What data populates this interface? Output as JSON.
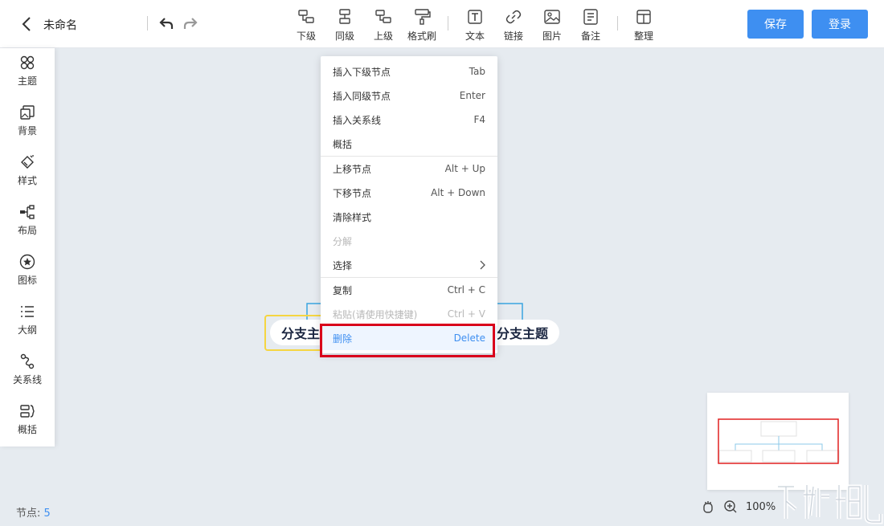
{
  "header": {
    "title": "未命名",
    "toolbar": [
      {
        "label": "下级",
        "icon": "insert-child-icon"
      },
      {
        "label": "同级",
        "icon": "insert-sibling-icon"
      },
      {
        "label": "上级",
        "icon": "insert-parent-icon"
      },
      {
        "label": "格式刷",
        "icon": "format-brush-icon"
      },
      {
        "label": "文本",
        "icon": "text-icon"
      },
      {
        "label": "链接",
        "icon": "link-icon"
      },
      {
        "label": "图片",
        "icon": "image-icon"
      },
      {
        "label": "备注",
        "icon": "note-icon"
      },
      {
        "label": "整理",
        "icon": "arrange-icon"
      }
    ],
    "save_label": "保存",
    "login_label": "登录"
  },
  "sidebar": {
    "items": [
      {
        "label": "主题",
        "icon": "theme-icon"
      },
      {
        "label": "背景",
        "icon": "background-icon"
      },
      {
        "label": "样式",
        "icon": "style-icon"
      },
      {
        "label": "布局",
        "icon": "layout-icon"
      },
      {
        "label": "图标",
        "icon": "star-icon"
      },
      {
        "label": "大纲",
        "icon": "outline-icon"
      },
      {
        "label": "关系线",
        "icon": "relation-line-icon"
      },
      {
        "label": "概括",
        "icon": "summary-icon"
      }
    ]
  },
  "canvas": {
    "nodes": [
      {
        "label": "分支主"
      },
      {
        "label": "分支主题"
      }
    ]
  },
  "context_menu": {
    "items": [
      {
        "label": "插入下级节点",
        "shortcut": "Tab"
      },
      {
        "label": "插入同级节点",
        "shortcut": "Enter"
      },
      {
        "label": "插入关系线",
        "shortcut": "F4"
      },
      {
        "label": "概括",
        "shortcut": ""
      },
      {
        "label": "上移节点",
        "shortcut": "Alt + Up"
      },
      {
        "label": "下移节点",
        "shortcut": "Alt + Down"
      },
      {
        "label": "清除样式",
        "shortcut": ""
      },
      {
        "label": "分解",
        "shortcut": ""
      },
      {
        "label": "选择",
        "shortcut": ""
      },
      {
        "label": "复制",
        "shortcut": "Ctrl + C"
      },
      {
        "label": "粘贴(请使用快捷键)",
        "shortcut": "Ctrl + V"
      },
      {
        "label": "删除",
        "shortcut": "Delete"
      }
    ]
  },
  "status": {
    "nodes_label": "节点:",
    "nodes_count": "5",
    "zoom": "100%"
  },
  "colors": {
    "accent": "#3e8ff1",
    "highlight_border": "#d9001b",
    "selection": "#f5d542",
    "canvas_bg": "#e6ebf0"
  }
}
